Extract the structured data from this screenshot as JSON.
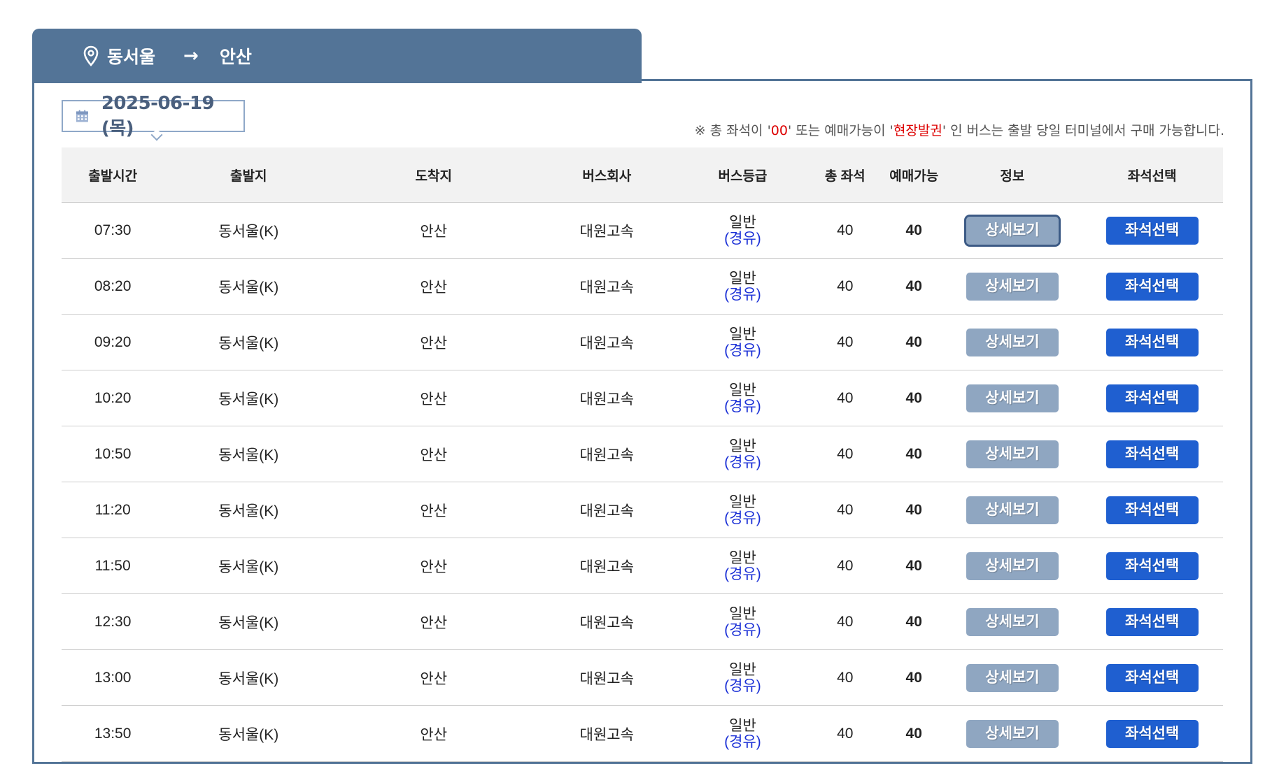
{
  "route": {
    "origin": "동서울",
    "arrow": "→",
    "destination": "안산"
  },
  "date": {
    "label": "2025-06-19 (목)"
  },
  "notice": {
    "prefix": "※ 총 좌석이 '",
    "highlight1": "00",
    "middle": "' 또는 예매가능이 '",
    "highlight2": "현장발권",
    "suffix": "' 인 버스는 출발 당일 터미널에서 구매 가능합니다."
  },
  "colors": {
    "header_bar": "#537497",
    "detail_button": "#8fa6c1",
    "seat_button": "#1f5fd0",
    "notice_highlight": "#dd0000",
    "grade_sub": "#1a2fd6"
  },
  "table": {
    "headers": [
      "출발시간",
      "출발지",
      "도착지",
      "버스회사",
      "버스등급",
      "총 좌석",
      "예매가능",
      "정보",
      "좌석선택"
    ],
    "detail_label": "상세보기",
    "seat_label": "좌석선택",
    "rows": [
      {
        "time": "07:30",
        "origin": "동서울(K)",
        "dest": "안산",
        "company": "대원고속",
        "grade": "일반",
        "grade_sub": "(경유)",
        "total": "40",
        "avail": "40"
      },
      {
        "time": "08:20",
        "origin": "동서울(K)",
        "dest": "안산",
        "company": "대원고속",
        "grade": "일반",
        "grade_sub": "(경유)",
        "total": "40",
        "avail": "40"
      },
      {
        "time": "09:20",
        "origin": "동서울(K)",
        "dest": "안산",
        "company": "대원고속",
        "grade": "일반",
        "grade_sub": "(경유)",
        "total": "40",
        "avail": "40"
      },
      {
        "time": "10:20",
        "origin": "동서울(K)",
        "dest": "안산",
        "company": "대원고속",
        "grade": "일반",
        "grade_sub": "(경유)",
        "total": "40",
        "avail": "40"
      },
      {
        "time": "10:50",
        "origin": "동서울(K)",
        "dest": "안산",
        "company": "대원고속",
        "grade": "일반",
        "grade_sub": "(경유)",
        "total": "40",
        "avail": "40"
      },
      {
        "time": "11:20",
        "origin": "동서울(K)",
        "dest": "안산",
        "company": "대원고속",
        "grade": "일반",
        "grade_sub": "(경유)",
        "total": "40",
        "avail": "40"
      },
      {
        "time": "11:50",
        "origin": "동서울(K)",
        "dest": "안산",
        "company": "대원고속",
        "grade": "일반",
        "grade_sub": "(경유)",
        "total": "40",
        "avail": "40"
      },
      {
        "time": "12:30",
        "origin": "동서울(K)",
        "dest": "안산",
        "company": "대원고속",
        "grade": "일반",
        "grade_sub": "(경유)",
        "total": "40",
        "avail": "40"
      },
      {
        "time": "13:00",
        "origin": "동서울(K)",
        "dest": "안산",
        "company": "대원고속",
        "grade": "일반",
        "grade_sub": "(경유)",
        "total": "40",
        "avail": "40"
      },
      {
        "time": "13:50",
        "origin": "동서울(K)",
        "dest": "안산",
        "company": "대원고속",
        "grade": "일반",
        "grade_sub": "(경유)",
        "total": "40",
        "avail": "40"
      }
    ]
  }
}
